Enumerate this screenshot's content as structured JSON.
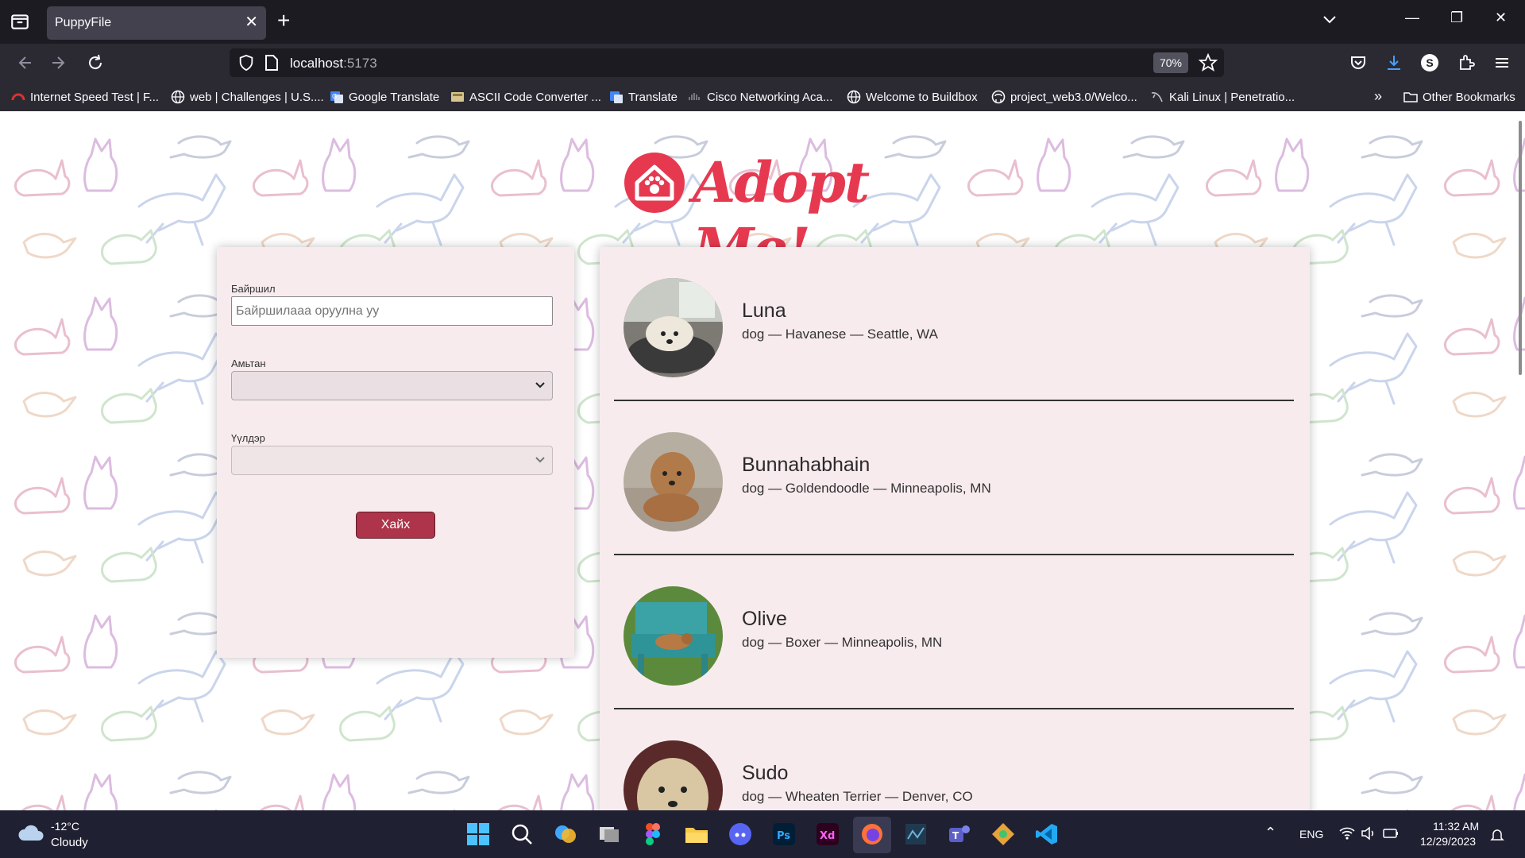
{
  "browser": {
    "tab_title": "PuppyFile",
    "url_host": "localhost",
    "url_port": ":5173",
    "zoom": "70%",
    "bookmarks": [
      "Internet Speed Test | F...",
      "web | Challenges | U.S....",
      "Google Translate",
      "ASCII Code Converter ...",
      "Translate",
      "Cisco Networking Aca...",
      "Welcome to Buildbox",
      "project_web3.0/Welco...",
      "Kali Linux | Penetratio..."
    ],
    "other_bookmarks": "Other Bookmarks",
    "profile_initial": "S"
  },
  "page": {
    "logo_text": "Adopt Me!",
    "search": {
      "location_label": "Байршил",
      "location_placeholder": "Байршилааа оруулна уу",
      "animal_label": "Амьтан",
      "breed_label": "Үүлдэр",
      "submit_label": "Хайх"
    },
    "pets": [
      {
        "name": "Luna",
        "info": "dog — Havanese — Seattle, WA"
      },
      {
        "name": "Bunnahabhain",
        "info": "dog — Goldendoodle — Minneapolis, MN"
      },
      {
        "name": "Olive",
        "info": "dog — Boxer — Minneapolis, MN"
      },
      {
        "name": "Sudo",
        "info": "dog — Wheaten Terrier — Denver, CO"
      }
    ]
  },
  "taskbar": {
    "weather_temp": "-12°C",
    "weather_desc": "Cloudy",
    "language": "ENG",
    "time": "11:32 AM",
    "date": "12/29/2023"
  },
  "colors": {
    "brand": "#e63950",
    "button": "#ad344a",
    "card_bg": "#f8ebee"
  }
}
